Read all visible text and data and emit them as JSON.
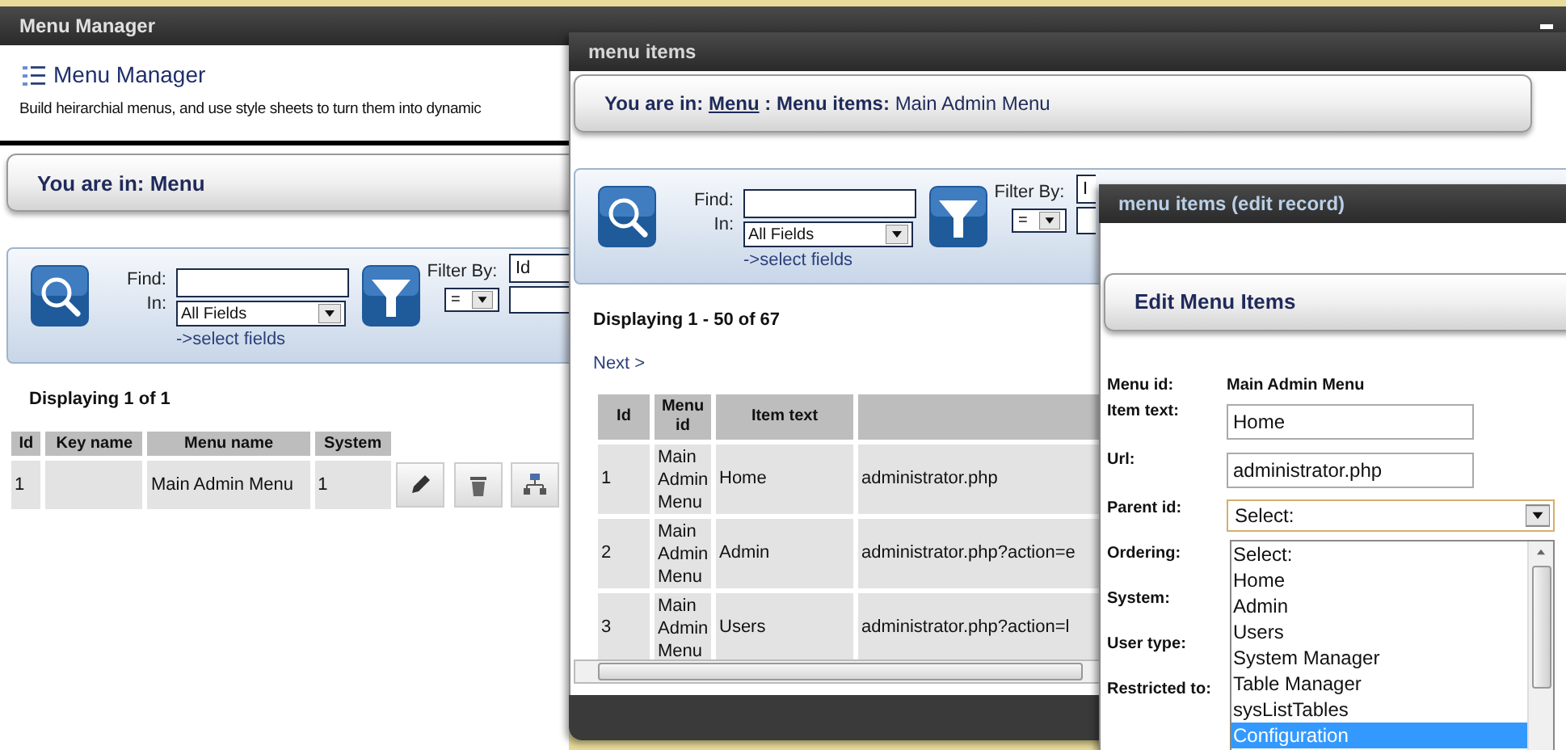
{
  "manager_window": {
    "title": "Menu Manager",
    "heading": "Menu Manager",
    "description": "Build heirarchial menus, and use style sheets to turn them into dynamic",
    "breadcrumb": "You are in: Menu",
    "search": {
      "find_label": "Find:",
      "in_label": "In:",
      "in_value": "All Fields",
      "select_fields_link": "->select fields",
      "filter_label": "Filter By:",
      "operator": "=",
      "filter_value": "Id"
    },
    "count": "Displaying 1 of 1",
    "table": {
      "columns": [
        "Id",
        "Key name",
        "Menu name",
        "System"
      ],
      "rows": [
        {
          "id": "1",
          "menu_name": "Main Admin Menu",
          "system": "1"
        }
      ]
    }
  },
  "items_window": {
    "title": "menu items",
    "breadcrumb": {
      "prefix": "You are in:",
      "link": "Menu",
      "section": ": Menu items:",
      "current": "Main Admin Menu"
    },
    "search": {
      "find_label": "Find:",
      "in_label": "In:",
      "in_value": "All Fields",
      "select_fields_link": "->select fields",
      "filter_label": "Filter By:",
      "operator": "=",
      "filter_value": "I"
    },
    "count": "Displaying 1 - 50 of 67",
    "next_link": "Next >",
    "table": {
      "columns": [
        "Id",
        "Menu id",
        "Item text"
      ],
      "rows": [
        {
          "id": "1",
          "menu_id": "Main Admin Menu",
          "item_text": "Home",
          "column_4": "administrator.php"
        },
        {
          "id": "2",
          "menu_id": "Main Admin Menu",
          "item_text": "Admin",
          "column_4": "administrator.php?action=e"
        },
        {
          "id": "3",
          "menu_id": "Main Admin Menu",
          "item_text": "Users",
          "column_4": "administrator.php?action=l"
        }
      ]
    }
  },
  "edit_window": {
    "title": "menu items (edit record)",
    "heading": "Edit Menu Items",
    "fields": [
      {
        "label": "Menu id:",
        "kind": "static",
        "value": "Main Admin Menu"
      },
      {
        "label": "Item text:",
        "kind": "text",
        "value": "Home"
      },
      {
        "label": "Url:",
        "kind": "text",
        "value": "administrator.php"
      },
      {
        "label": "Parent id:",
        "kind": "select",
        "value": "Select:"
      },
      {
        "label": "Ordering:",
        "kind": "covered"
      },
      {
        "label": "System:",
        "kind": "covered"
      },
      {
        "label": "User type:",
        "kind": "covered"
      },
      {
        "label": "Restricted to:",
        "kind": "covered"
      }
    ],
    "dropdown": [
      {
        "label": "Select:",
        "selected": false
      },
      {
        "label": "Home",
        "selected": false
      },
      {
        "label": "Admin",
        "selected": false
      },
      {
        "label": "Users",
        "selected": false
      },
      {
        "label": "System Manager",
        "selected": false
      },
      {
        "label": "Table Manager",
        "selected": false
      },
      {
        "label": "sysListTables",
        "selected": false
      },
      {
        "label": "Configuration",
        "selected": true
      }
    ]
  }
}
